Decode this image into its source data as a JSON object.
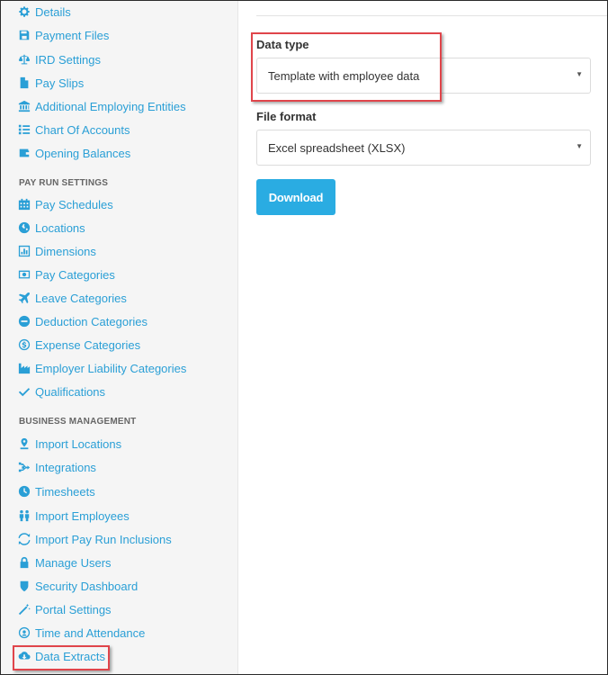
{
  "sidebar": {
    "items_top": [
      {
        "label": "Details",
        "icon": "gear-icon"
      },
      {
        "label": "Payment Files",
        "icon": "floppy-disk-icon"
      },
      {
        "label": "IRD Settings",
        "icon": "scales-icon"
      },
      {
        "label": "Pay Slips",
        "icon": "document-icon"
      },
      {
        "label": "Additional Employing Entities",
        "icon": "institution-icon"
      },
      {
        "label": "Chart Of Accounts",
        "icon": "list-icon"
      },
      {
        "label": "Opening Balances",
        "icon": "wallet-icon"
      }
    ],
    "pay_run_heading": "PAY RUN SETTINGS",
    "pay_run_items": [
      {
        "label": "Pay Schedules",
        "icon": "calendar-icon"
      },
      {
        "label": "Locations",
        "icon": "globe-icon"
      },
      {
        "label": "Dimensions",
        "icon": "bar-chart-icon"
      },
      {
        "label": "Pay Categories",
        "icon": "money-icon"
      },
      {
        "label": "Leave Categories",
        "icon": "plane-icon"
      },
      {
        "label": "Deduction Categories",
        "icon": "minus-circle-icon"
      },
      {
        "label": "Expense Categories",
        "icon": "dollar-circle-icon"
      },
      {
        "label": "Employer Liability Categories",
        "icon": "industry-icon"
      },
      {
        "label": "Qualifications",
        "icon": "check-icon"
      }
    ],
    "business_heading": "BUSINESS MANAGEMENT",
    "business_items": [
      {
        "label": "Import Locations",
        "icon": "map-pin-icon"
      },
      {
        "label": "Integrations",
        "icon": "integrations-icon"
      },
      {
        "label": "Timesheets",
        "icon": "clock-icon"
      },
      {
        "label": "Import Employees",
        "icon": "users-icon"
      },
      {
        "label": "Import Pay Run Inclusions",
        "icon": "refresh-icon"
      },
      {
        "label": "Manage Users",
        "icon": "lock-icon"
      },
      {
        "label": "Security Dashboard",
        "icon": "shield-icon"
      },
      {
        "label": "Portal Settings",
        "icon": "magic-wand-icon"
      },
      {
        "label": "Time and Attendance",
        "icon": "user-clock-icon"
      },
      {
        "label": "Data Extracts",
        "icon": "cloud-download-icon"
      }
    ]
  },
  "form": {
    "data_type_label": "Data type",
    "data_type_value": "Template with employee data",
    "file_format_label": "File format",
    "file_format_value": "Excel spreadsheet (XLSX)",
    "download_label": "Download"
  },
  "colors": {
    "link": "#2a9fd6",
    "button": "#2aace2",
    "highlight": "#e0454b"
  }
}
